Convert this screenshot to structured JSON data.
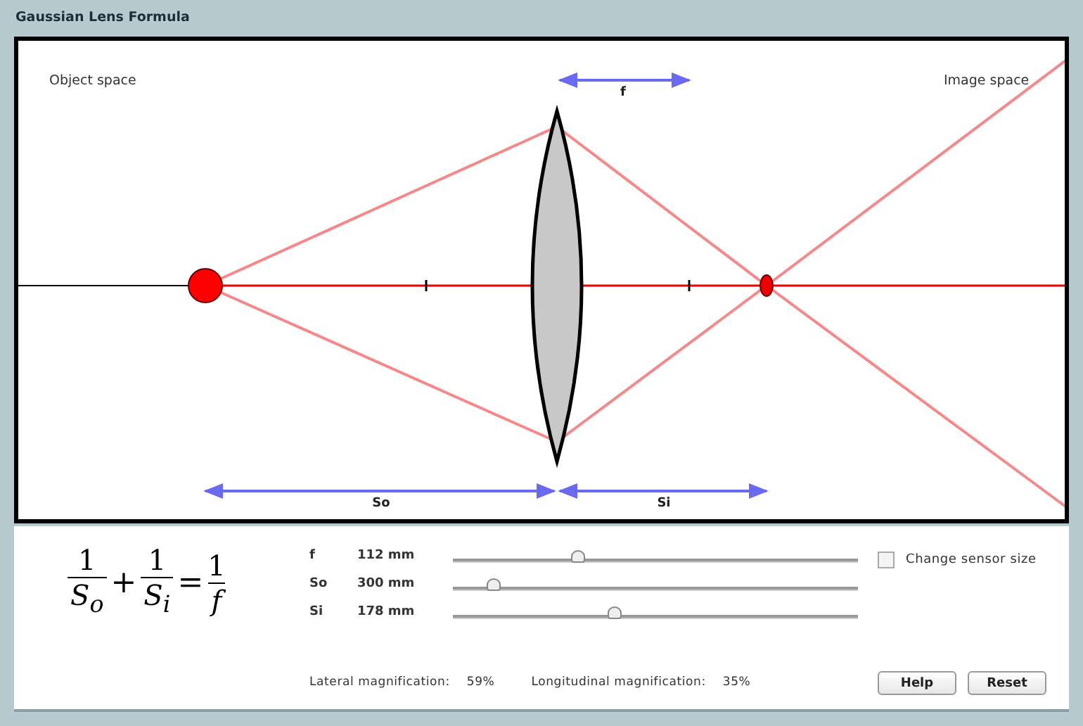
{
  "window": {
    "title": "Gaussian Lens Formula"
  },
  "diagram": {
    "object_space_label": "Object space",
    "image_space_label": "Image space",
    "focal_label": "f",
    "object_distance_label": "So",
    "image_distance_label": "Si"
  },
  "formula": [
    {
      "kind": "fraction",
      "numerator": "1",
      "denominator": "S$_{o}$"
    },
    {
      "kind": "operator",
      "symbol": "+"
    },
    {
      "kind": "fraction",
      "numerator": "1",
      "denominator": "S$_{i}$"
    },
    {
      "kind": "operator",
      "symbol": "="
    },
    {
      "kind": "fraction",
      "numerator": "1",
      "denominator": "f"
    }
  ],
  "sliders": [
    {
      "label": "f",
      "reading": "112 mm",
      "level": 0.31
    },
    {
      "label": "So",
      "reading": "300 mm",
      "level": 0.1
    },
    {
      "label": "Si",
      "reading": "178 mm",
      "level": 0.4
    }
  ],
  "sensor_checkbox": {
    "label": "Change sensor size",
    "checked": false
  },
  "magnification": [
    {
      "label": "Lateral magnification:",
      "value": "59%"
    },
    {
      "label": "Longitudinal magnification:",
      "value": "35%"
    }
  ],
  "buttons": [
    "Help",
    "Reset"
  ]
}
